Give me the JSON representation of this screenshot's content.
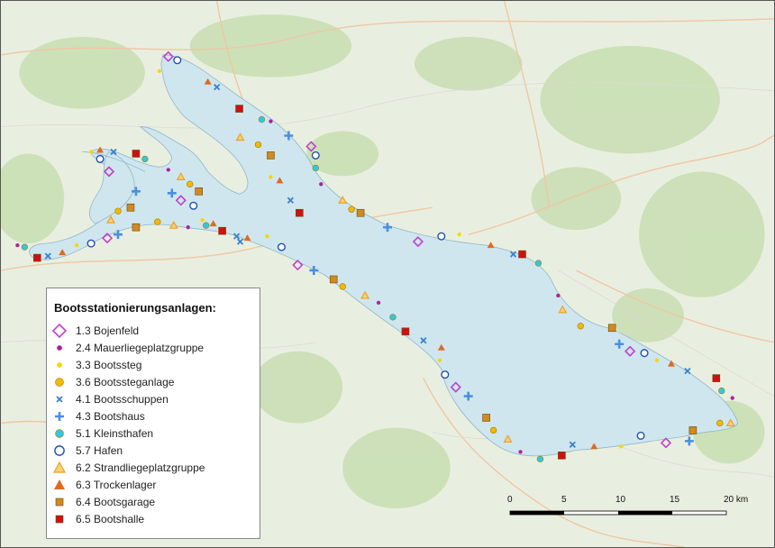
{
  "legend": {
    "title": "Bootsstationierungsanlagen:",
    "items": [
      {
        "label": "1.3 Bojenfeld",
        "icon": "diamond-outline-icon",
        "color": "#c040c8"
      },
      {
        "label": "2.4 Mauerliegeplatzgruppe",
        "icon": "small-dot-icon",
        "color": "#b0209a"
      },
      {
        "label": "3.3 Bootssteg",
        "icon": "small-dot-icon",
        "color": "#f4d80a"
      },
      {
        "label": "3.6 Bootssteganlage",
        "icon": "dot-icon",
        "color": "#f4b800"
      },
      {
        "label": "4.1 Bootsschuppen",
        "icon": "x-icon",
        "color": "#3c7fd0"
      },
      {
        "label": "4.3 Bootshaus",
        "icon": "plus-icon",
        "color": "#4a8fe0"
      },
      {
        "label": "5.1 Kleinsthafen",
        "icon": "dot-icon",
        "color": "#30c8e0"
      },
      {
        "label": "5.7 Hafen",
        "icon": "circle-outline-icon",
        "color": "#1f4fb0"
      },
      {
        "label": "6.2 Strandliegeplatzgruppe",
        "icon": "triangle-outline-icon",
        "color": "#f0a020"
      },
      {
        "label": "6.3 Trockenlager",
        "icon": "triangle-icon",
        "color": "#e06a20"
      },
      {
        "label": "6.4 Bootsgarage",
        "icon": "square-icon",
        "color": "#d08a20"
      },
      {
        "label": "6.5 Bootshalle",
        "icon": "square-icon",
        "color": "#d01010"
      }
    ]
  },
  "scalebar": {
    "ticks": [
      "0",
      "5",
      "10",
      "15",
      "20 km"
    ],
    "values_km": [
      0,
      5,
      10,
      15,
      20
    ]
  },
  "colors": {
    "water": "#cfe6ef",
    "land": "#e9efe0",
    "forest": "#c9ddb4",
    "roads": "#f1c8a8"
  }
}
